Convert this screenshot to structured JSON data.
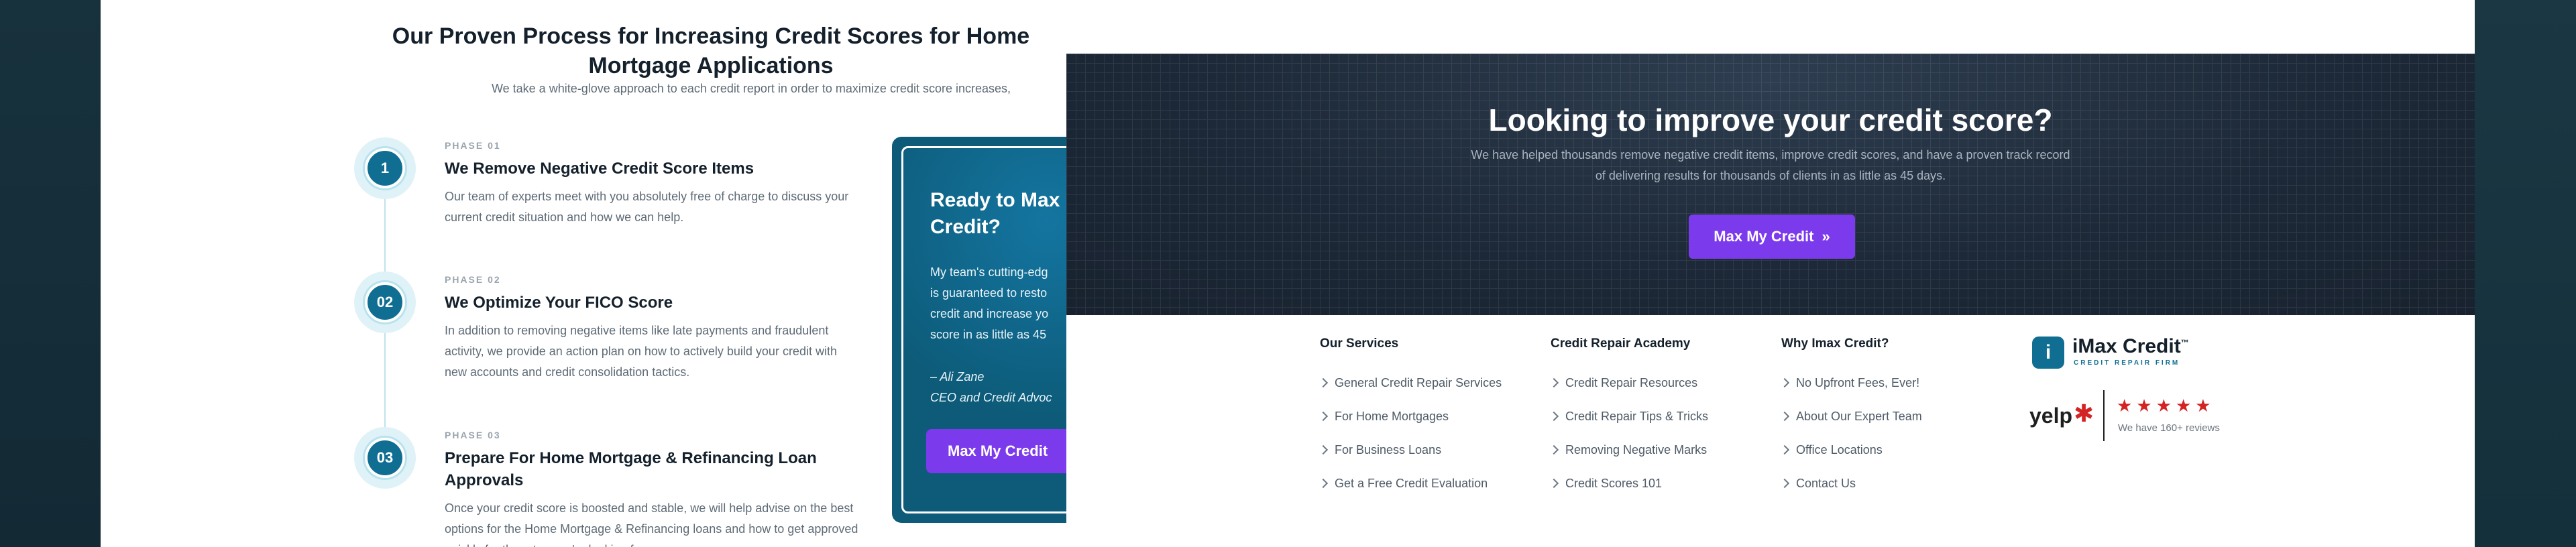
{
  "process": {
    "title": "Our Proven Process for Increasing Credit Scores for Home Mortgage Applications",
    "subtitle": "We take a white-glove approach to each credit report in order to maximize credit score increases,",
    "phases": [
      {
        "badge": "1",
        "label": "PHASE 01",
        "heading": "We Remove Negative Credit Score Items",
        "desc": "Our team of experts meet with you absolutely free of charge to discuss your current credit situation and how we can help."
      },
      {
        "badge": "02",
        "label": "PHASE 02",
        "heading": "We Optimize Your FICO Score",
        "desc": "In addition to removing negative items like late payments and fraudulent activity, we provide an action plan on how to actively build your credit with new accounts and credit consolidation tactics."
      },
      {
        "badge": "03",
        "label": "PHASE 03",
        "heading": "Prepare For Home Mortgage & Refinancing Loan Approvals",
        "desc": "Once your credit score is boosted and stable, we will help advise on the best options for the Home Mortgage & Refinancing loans and how to get approved quickly for the rates you're looking for."
      }
    ]
  },
  "cta_card": {
    "title_line1": "Ready to Max",
    "title_line2": "Credit?",
    "body_lines": [
      "My team's cutting-edg",
      "is guaranteed to resto",
      "credit and increase yo",
      "score in as little as 45"
    ],
    "quote_name": "– Ali Zane",
    "quote_role": "CEO and Credit Advoc",
    "button_label": "Max My Credit"
  },
  "hero": {
    "title": "Looking to improve your credit score?",
    "desc": "We have helped thousands remove negative credit items, improve credit scores, and have a proven track record of delivering results for thousands of clients in as little as 45 days.",
    "button_label": "Max My Credit",
    "button_icon": "double-chevron-right-icon"
  },
  "footer": {
    "columns": [
      {
        "title": "Our Services",
        "items": [
          "General Credit Repair Services",
          "For Home Mortgages",
          "For Business Loans",
          "Get a Free Credit Evaluation"
        ]
      },
      {
        "title": "Credit Repair Academy",
        "items": [
          "Credit Repair Resources",
          "Credit Repair Tips & Tricks",
          "Removing Negative Marks",
          "Credit Scores 101"
        ]
      },
      {
        "title": "Why Imax Credit?",
        "items": [
          "No Upfront Fees, Ever!",
          "About Our Expert Team",
          "Office Locations",
          "Contact Us"
        ]
      }
    ],
    "brand": {
      "logo_letter": "i",
      "name": "iMax Credit",
      "trademark": "™",
      "tagline": "CREDIT REPAIR FIRM"
    },
    "yelp": {
      "wordmark": "yelp",
      "rating": 5,
      "reviews": "We have 160+ reviews"
    }
  },
  "colors": {
    "accent_purple": "#7c3aed",
    "brand_teal": "#0f6e91",
    "hero_dark": "#1d2938",
    "yelp_red": "#d32323"
  }
}
